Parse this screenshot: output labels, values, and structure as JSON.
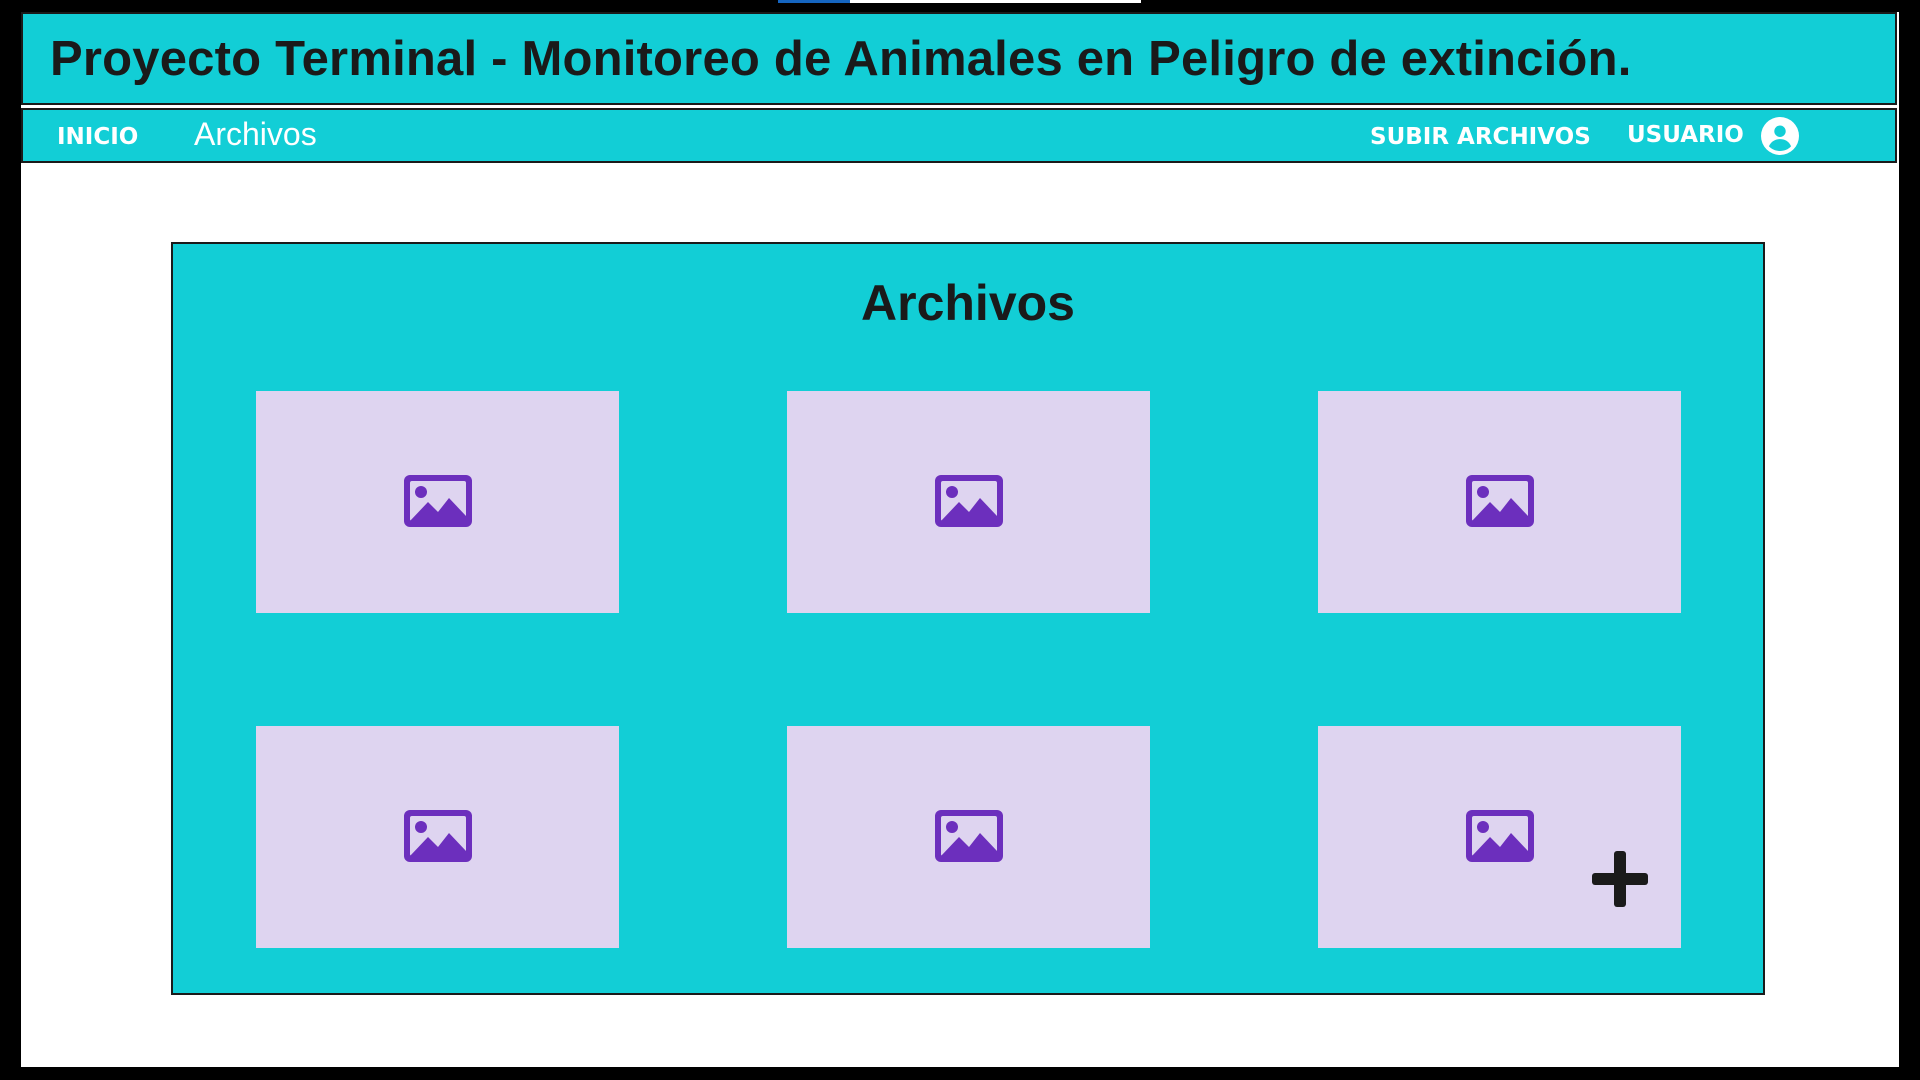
{
  "header": {
    "title": "Proyecto Terminal - Monitoreo de Animales en Peligro de extinción."
  },
  "nav": {
    "inicio": "INICIO",
    "archivos": "Archivos",
    "subir_archivos": "SUBIR ARCHIVOS",
    "usuario": "USUARIO",
    "user_icon": "account-circle-icon"
  },
  "main": {
    "title": "Archivos",
    "tiles": [
      {
        "icon": "image-icon"
      },
      {
        "icon": "image-icon"
      },
      {
        "icon": "image-icon"
      },
      {
        "icon": "image-icon"
      },
      {
        "icon": "image-icon"
      },
      {
        "icon": "image-icon",
        "extra_icon": "plus-icon"
      }
    ]
  },
  "colors": {
    "accent": "#12ced6",
    "tile_bg": "#ded4f0",
    "icon_purple": "#6c2fbd",
    "text_dark": "#1a1a1a",
    "nav_text": "#ffffff"
  }
}
